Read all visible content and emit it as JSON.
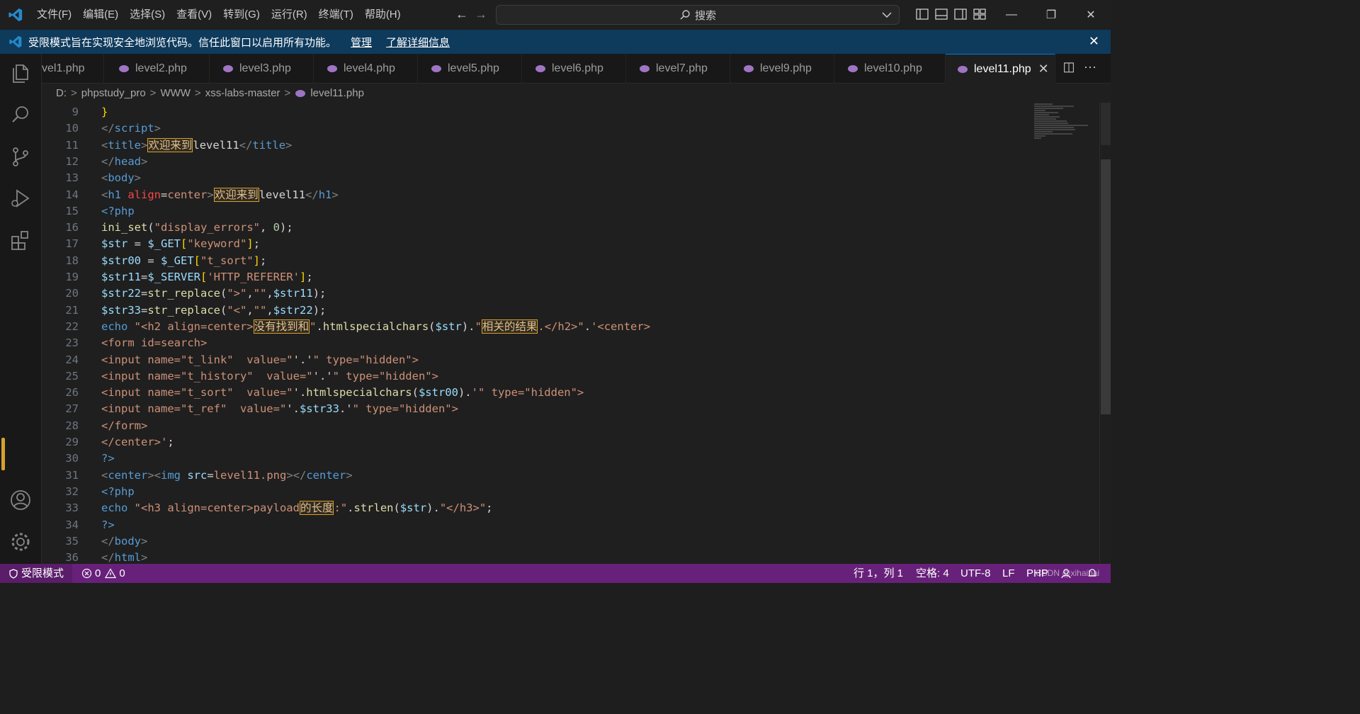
{
  "titlebar": {
    "menu": [
      "文件(F)",
      "编辑(E)",
      "选择(S)",
      "查看(V)",
      "转到(G)",
      "运行(R)",
      "终端(T)",
      "帮助(H)"
    ],
    "back_arrow": "←",
    "forward_arrow": "→",
    "search_label": "搜索",
    "minimize": "—",
    "restore": "❐",
    "close": "✕"
  },
  "banner": {
    "message": "受限模式旨在实现安全地浏览代码。信任此窗口以启用所有功能。",
    "manage": "管理",
    "learn_more": "了解详细信息",
    "close": "✕"
  },
  "tabs": [
    {
      "label": "vel1.php"
    },
    {
      "label": "level2.php"
    },
    {
      "label": "level3.php"
    },
    {
      "label": "level4.php"
    },
    {
      "label": "level5.php"
    },
    {
      "label": "level6.php"
    },
    {
      "label": "level7.php"
    },
    {
      "label": "level9.php"
    },
    {
      "label": "level10.php"
    },
    {
      "label": "level11.php",
      "close": "✕"
    }
  ],
  "tab_actions": {
    "split": "◫",
    "more": "···"
  },
  "breadcrumb": {
    "parts": [
      "D:",
      "phpstudy_pro",
      "WWW",
      "xss-labs-master",
      "level11.php"
    ],
    "sep": ">"
  },
  "editor": {
    "line_numbers": [
      "9",
      "10",
      "11",
      "12",
      "13",
      "14",
      "15",
      "16",
      "17",
      "18",
      "19",
      "20",
      "21",
      "22",
      "23",
      "24",
      "25",
      "26",
      "27",
      "28",
      "29",
      "30",
      "31",
      "32",
      "33",
      "34",
      "35",
      "36"
    ]
  },
  "statusbar": {
    "restricted": "受限模式",
    "errors": "0",
    "warnings": "0",
    "position": "行 1，列 1",
    "spaces": "空格: 4",
    "encoding": "UTF-8",
    "eol": "LF",
    "language": "PHP",
    "watermark": "CSDN @xihaihai"
  },
  "colors": {
    "statusbar": "#68217a",
    "banner": "#0e3a5c",
    "accent": "#0078d4",
    "highlight_border": "#d7a12d",
    "php_icon": "#a074c4"
  }
}
